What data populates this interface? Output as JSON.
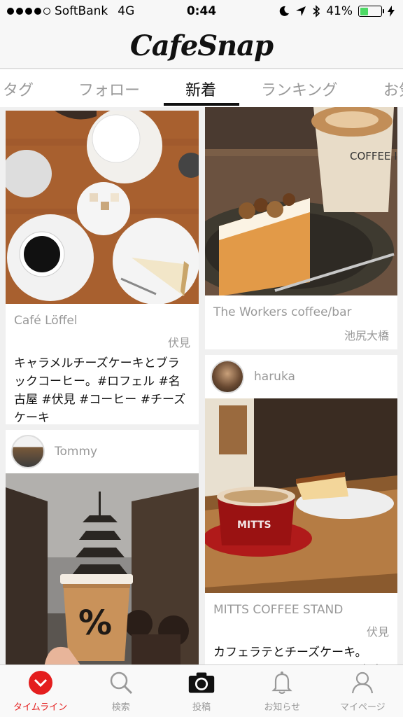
{
  "status_bar": {
    "carrier": "SoftBank",
    "network": "4G",
    "time": "0:44",
    "battery": "41%",
    "battery_level": 0.41
  },
  "header": {
    "logo": "CafeSnap"
  },
  "tabs": [
    {
      "label": "タグ"
    },
    {
      "label": "フォロー"
    },
    {
      "label": "新着",
      "active": true
    },
    {
      "label": "ランキング"
    },
    {
      "label": "お気"
    }
  ],
  "feed": {
    "left": [
      {
        "shop": "Café Löffel",
        "area": "伏見",
        "caption": "キャラメルチーズケーキとブラックコーヒー。#ロフェル #名古屋 #伏見 #コーヒー #チーズケーキ"
      },
      {
        "user": "Tommy"
      }
    ],
    "right": [
      {
        "shop": "The Workers coffee/bar",
        "area": "池尻大橋"
      },
      {
        "user": "haruka",
        "shop": "MITTS COFFEE STAND",
        "area": "伏見",
        "caption": "カフェラテとチーズケーキ。#MITTSCOFFEESTAND #名古"
      }
    ]
  },
  "cup_print": {
    "coffee_cup": "COFFEE IS MY BOYFR",
    "mitts_cup": "MITTS",
    "percent_cup": "%"
  },
  "tabbar": [
    {
      "label": "タイムライン",
      "icon": "timeline-icon",
      "active": true
    },
    {
      "label": "検索",
      "icon": "search-icon"
    },
    {
      "label": "投稿",
      "icon": "camera-icon"
    },
    {
      "label": "お知らせ",
      "icon": "bell-icon"
    },
    {
      "label": "マイページ",
      "icon": "person-icon"
    }
  ],
  "colors": {
    "accent": "#e41e1e",
    "battery": "#4cd964"
  }
}
